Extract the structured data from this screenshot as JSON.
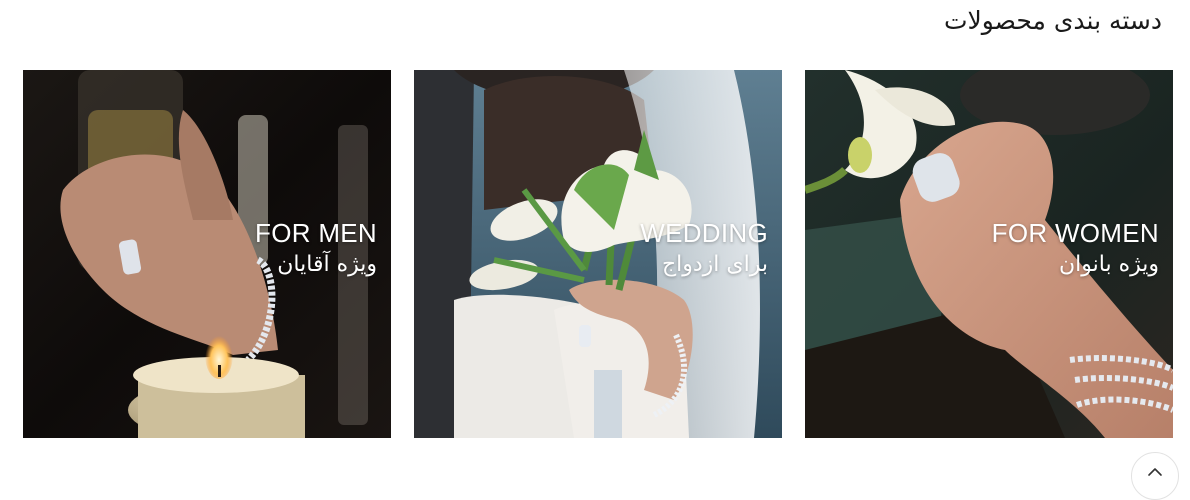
{
  "section": {
    "title": "دسته بندی محصولات"
  },
  "categories": [
    {
      "title_en": "FOR MEN",
      "title_fa": "ویژه آقایان",
      "image": "hand-with-ring-champagne-candle"
    },
    {
      "title_en": "WEDDING",
      "title_fa": "برای ازدواج",
      "image": "bride-holding-white-tulip-bouquet"
    },
    {
      "title_en": "FOR WOMEN",
      "title_fa": "ویژه بانوان",
      "image": "hand-with-ring-and-bracelet-calla-lily"
    }
  ],
  "scroll_top": {
    "icon": "chevron-up-icon"
  }
}
